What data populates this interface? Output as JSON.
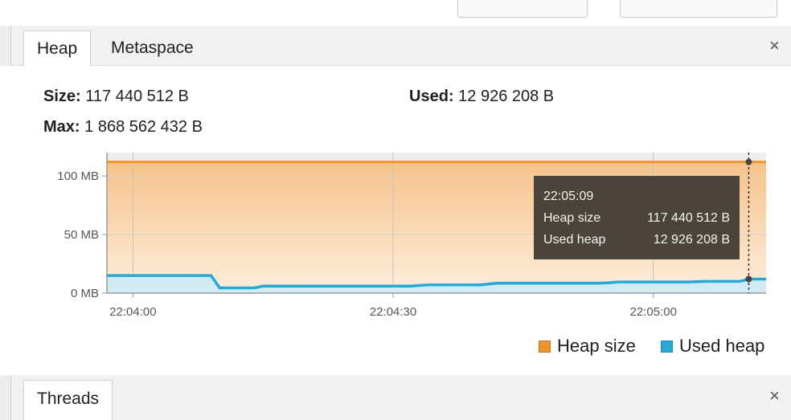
{
  "heap_panel": {
    "tabs": [
      {
        "label": "Heap",
        "active": true
      },
      {
        "label": "Metaspace",
        "active": false
      }
    ],
    "close_label": "×",
    "stats": {
      "size_label": "Size:",
      "size_value": "117 440 512 B",
      "used_label": "Used:",
      "used_value": "12 926 208 B",
      "max_label": "Max:",
      "max_value": "1 868 562 432 B"
    }
  },
  "chart_data": {
    "type": "area",
    "title": "",
    "xlabel": "",
    "ylabel": "",
    "y_ticks": [
      "100 MB",
      "50 MB",
      "0 MB"
    ],
    "y_tick_values": [
      100,
      50,
      0
    ],
    "ylim": [
      0,
      120
    ],
    "x_ticks": [
      "22:04:00",
      "22:04:30",
      "22:05:00"
    ],
    "x_tick_values": [
      0,
      30,
      60
    ],
    "xlim": [
      -3,
      73
    ],
    "series": [
      {
        "name": "Heap size",
        "color": "#f0942c",
        "x": [
          -3,
          73
        ],
        "y": [
          112,
          112
        ]
      },
      {
        "name": "Used heap",
        "color": "#27a9d8",
        "x": [
          -3,
          9,
          10,
          14,
          15,
          22,
          32,
          34,
          40,
          42,
          54,
          56,
          64,
          66,
          70,
          71,
          73
        ],
        "y": [
          15,
          15,
          4.5,
          4.5,
          6,
          6,
          6,
          7,
          7,
          8.5,
          8.5,
          9.5,
          9.5,
          10,
          10,
          12,
          12
        ]
      }
    ],
    "grid": true,
    "legend_position": "bottom-right",
    "cursor_time": 71
  },
  "tooltip": {
    "time": "22:05:09",
    "rows": [
      {
        "label": "Heap size",
        "value": "117 440 512 B"
      },
      {
        "label": "Used heap",
        "value": "12 926 208 B"
      }
    ]
  },
  "legend": [
    {
      "label": "Heap size",
      "color": "#f0942c"
    },
    {
      "label": "Used heap",
      "color": "#27a9d8"
    }
  ],
  "threads_panel": {
    "tab_label": "Threads",
    "close_label": "×"
  }
}
